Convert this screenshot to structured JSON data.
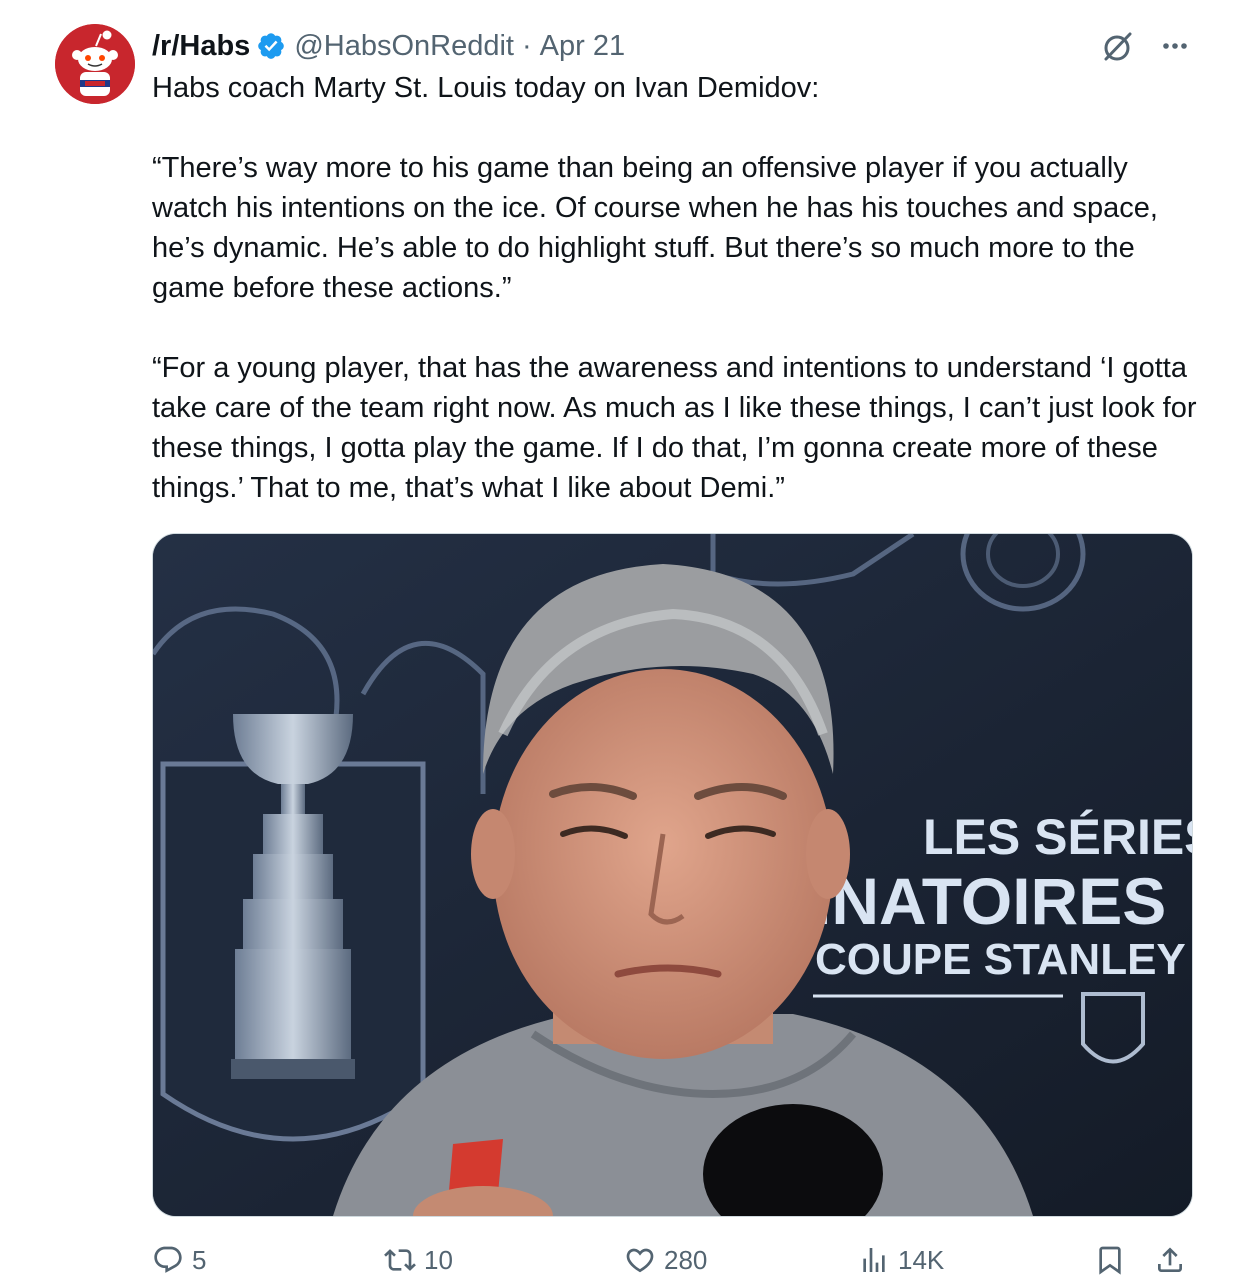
{
  "author": {
    "display_name": "/r/Habs",
    "handle": "@HabsOnReddit",
    "separator": "·",
    "date": "Apr 21",
    "avatar_icon": "reddit-snoo-habs-avatar",
    "verified_icon": "verified-badge-icon",
    "verified_color": "#1d9bf0"
  },
  "tweet": {
    "paragraphs": [
      "Habs coach Marty St. Louis today on Ivan Demidov:",
      "“There’s way more to his game than being an offensive player if you actually watch his intentions on the ice. Of course when he has his touches and space, he’s dynamic. He’s able to do highlight stuff. But there’s so much more to the game before these actions.”",
      "“For a young player, that has the awareness and intentions to understand ‘I gotta take care of the team right now. As much as I like these things, I can’t just look for these things, I gotta play the game. If I do that, I’m gonna create more of these things.’ That to me, that’s what I like about Demi.”"
    ]
  },
  "media": {
    "backdrop_lines": [
      "LES SÉRIES",
      "INATOIRES",
      "COUPE STANLEY"
    ],
    "backdrop_colors": {
      "background": "#1b2432",
      "text": "#d9e4f2"
    }
  },
  "actions": {
    "reply": {
      "icon": "reply-icon",
      "count": "5"
    },
    "repost": {
      "icon": "repost-icon",
      "count": "10"
    },
    "like": {
      "icon": "heart-icon",
      "count": "280"
    },
    "views": {
      "icon": "views-chart-icon",
      "count": "14K"
    },
    "bookmark": {
      "icon": "bookmark-icon"
    },
    "share": {
      "icon": "share-icon"
    }
  },
  "colors": {
    "text_primary": "#0f1419",
    "text_secondary": "#536471",
    "border": "#cfd9de"
  }
}
